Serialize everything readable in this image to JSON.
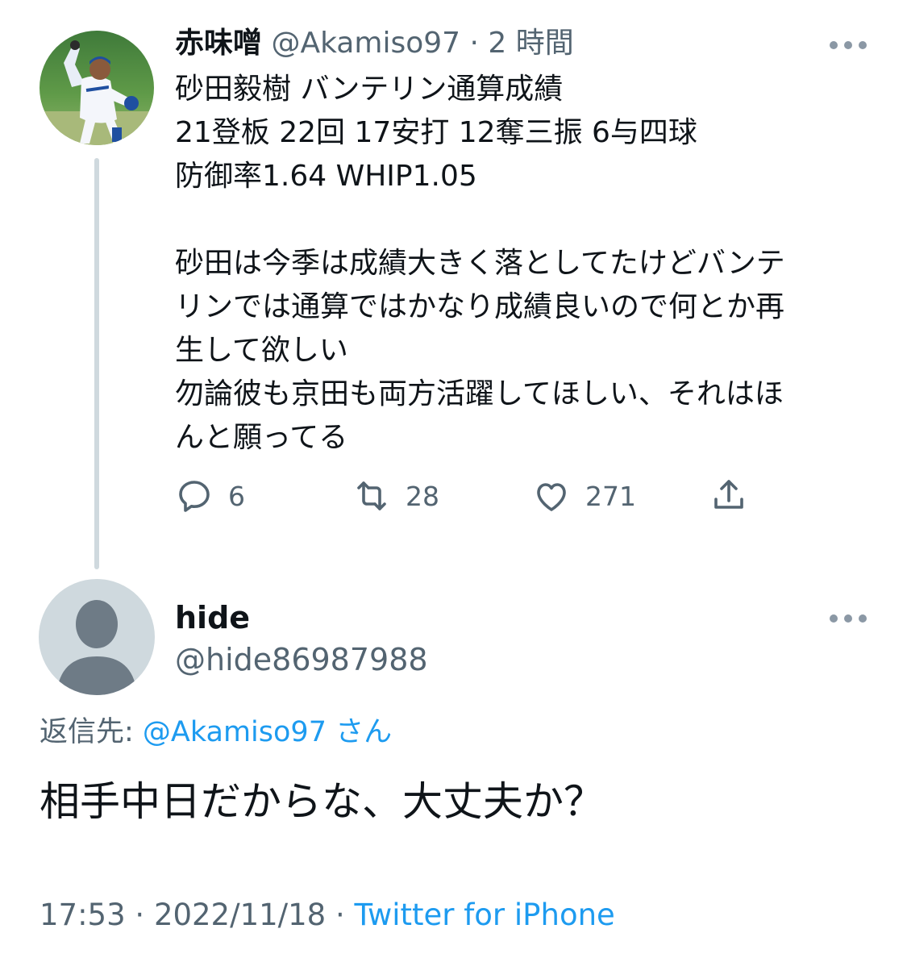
{
  "parent_tweet": {
    "display_name": "赤味噌",
    "handle": "@Akamiso97",
    "separator": "·",
    "time_ago": "2 時間",
    "text": "砂田毅樹 バンテリン通算成績\n21登板 22回 17安打 12奪三振 6与四球\n防御率1.64 WHIP1.05\n\n砂田は今季は成績大きく落としてたけどバンテ\nリンでは通算ではかなり成績良いので何とか再\n生して欲しい\n勿論彼も京田も両方活躍してほしい、それはほ\nんと願ってる",
    "actions": {
      "reply_count": "6",
      "retweet_count": "28",
      "like_count": "271"
    },
    "icons": {
      "reply": "speech-bubble-icon",
      "retweet": "retweet-icon",
      "like": "heart-icon",
      "share": "share-icon",
      "more": "more-icon"
    }
  },
  "reply_tweet": {
    "display_name": "hide",
    "handle": "@hide86987988",
    "reply_prefix": "返信先: ",
    "reply_mention": "@Akamiso97",
    "reply_suffix": " さん",
    "text": "相手中日だからな、大丈夫か？",
    "footer": {
      "time": "17:53",
      "separator1": " · ",
      "date": "2022/11/18",
      "separator2": " · ",
      "source": "Twitter for iPhone"
    }
  },
  "colors": {
    "text": "#0f1419",
    "secondary": "#536471",
    "link": "#1d9bf0",
    "thread_line": "#cfd9de",
    "default_avatar_bg": "#cfd9de",
    "default_avatar_fg": "#6e7b86"
  }
}
